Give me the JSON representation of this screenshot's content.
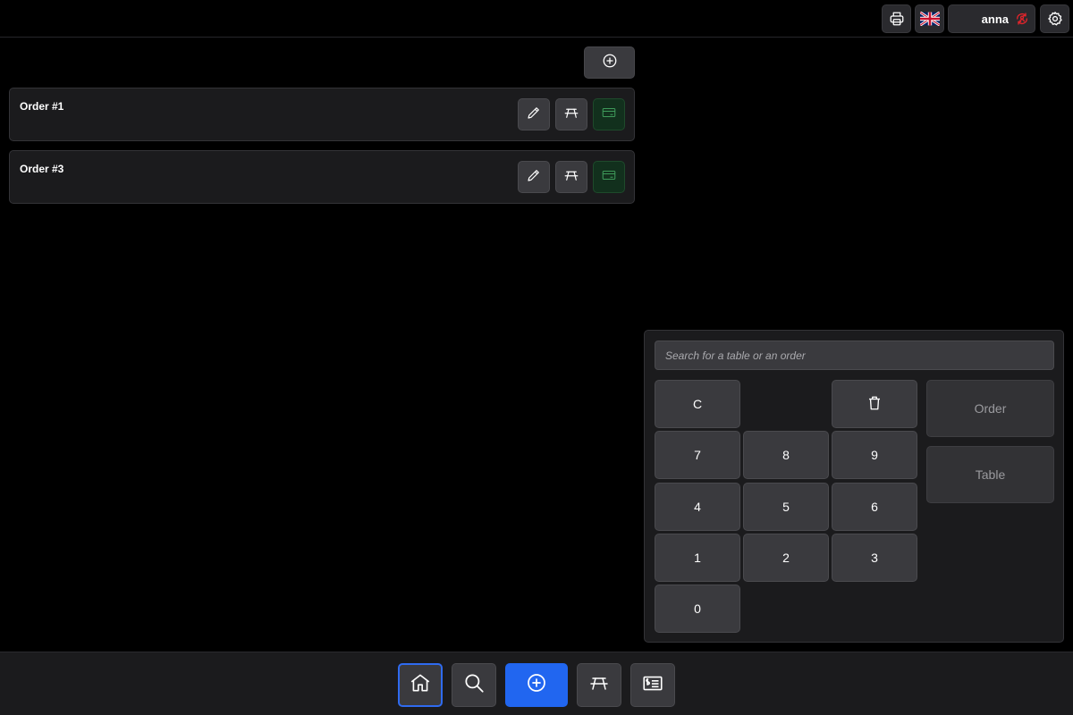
{
  "header": {
    "user_name": "anna",
    "icons": [
      "print-icon",
      "uk-flag-icon",
      "user-sync-icon",
      "settings-icon"
    ],
    "sync_status_color": "#e0242b"
  },
  "orders": [
    {
      "title": "Order #1"
    },
    {
      "title": "Order #3"
    }
  ],
  "search": {
    "placeholder": "Search for a table or an order",
    "value": ""
  },
  "keypad": {
    "clear": "C",
    "k7": "7",
    "k8": "8",
    "k9": "9",
    "k4": "4",
    "k5": "5",
    "k6": "6",
    "k1": "1",
    "k2": "2",
    "k3": "3",
    "k0": "0"
  },
  "actions": {
    "order_label": "Order",
    "table_label": "Table"
  },
  "bottom_nav": {
    "items": [
      "home-icon",
      "search-icon",
      "add-icon",
      "table-icon",
      "receipt-icon"
    ],
    "active": "home-icon"
  },
  "colors": {
    "accent": "#2166f0",
    "pay": "#12301d"
  }
}
